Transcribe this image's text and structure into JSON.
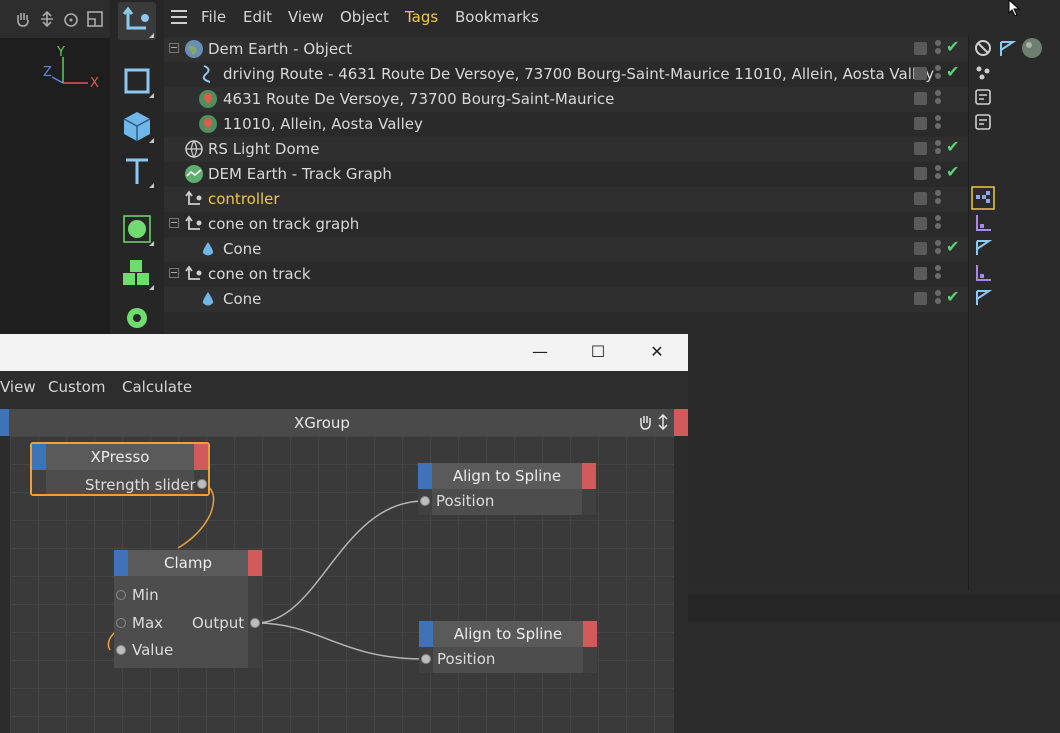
{
  "object_manager": {
    "menu": [
      "File",
      "Edit",
      "View",
      "Object",
      "Tags",
      "Bookmarks"
    ],
    "active_menu_color": "#f0c64a",
    "rows": [
      {
        "label": "Dem Earth - Object",
        "icon": "globe-icon",
        "check": true,
        "expander": true
      },
      {
        "label": "driving Route - 4631 Route De Versoye, 73700 Bourg-Saint-Maurice 11010, Allein, Aosta Valley",
        "icon": "spline-icon",
        "check": true
      },
      {
        "label": "4631 Route De Versoye, 73700 Bourg-Saint-Maurice",
        "icon": "map-pin-icon",
        "check": false
      },
      {
        "label": "11010, Allein, Aosta Valley",
        "icon": "map-pin-icon",
        "check": false
      },
      {
        "label": "RS Light Dome",
        "icon": "light-dome-icon",
        "check": true
      },
      {
        "label": "DEM Earth - Track Graph",
        "icon": "track-graph-icon",
        "check": true
      },
      {
        "label": "controller",
        "icon": "null-object-icon",
        "check": false,
        "highlight": true
      },
      {
        "label": "cone on track graph",
        "icon": "null-object-icon",
        "check": false,
        "expander": true
      },
      {
        "label": "Cone",
        "icon": "cone-icon",
        "check": true
      },
      {
        "label": "cone on track",
        "icon": "null-object-icon",
        "check": false,
        "expander": true
      },
      {
        "label": "Cone",
        "icon": "cone-icon",
        "check": true
      }
    ]
  },
  "viewport": {
    "axis_y": "Y",
    "axis_z": "Z",
    "axis_x": "X"
  },
  "xpresso_window": {
    "menu": [
      "View",
      "Custom",
      "Calculate"
    ],
    "window_buttons": [
      "—",
      "☐",
      "✕"
    ],
    "group_title": "XGroup",
    "nodes": {
      "xpresso": {
        "title": "XPresso",
        "port": "Strength slider"
      },
      "clamp": {
        "title": "Clamp",
        "inputs": [
          "Min",
          "Max",
          "Value"
        ],
        "output": "Output"
      },
      "align1": {
        "title": "Align to Spline",
        "port": "Position"
      },
      "align2": {
        "title": "Align to Spline",
        "port": "Position"
      }
    }
  }
}
